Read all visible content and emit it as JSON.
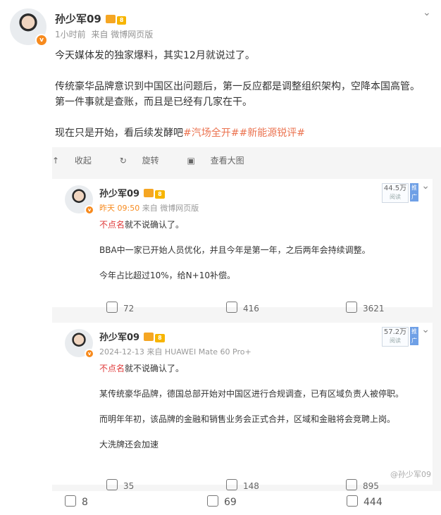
{
  "main": {
    "username": "孙少军09",
    "level_badge": "8",
    "avatar_badge": "v",
    "time": "1小时前",
    "source": "来自 微博网页版",
    "paragraphs": [
      "今天媒体发的独家爆料，其实12月就说过了。",
      "传统豪华品牌意识到中国区出问题后，第一反应都是调整组织架构，空降本国高管。第一件事就是查账，而且是已经有几家在干。",
      "现在只是开始，看后续发酵吧"
    ],
    "tags": [
      "#汽场全开#",
      "#新能源锐评#"
    ]
  },
  "repost_bar": {
    "collect": "收起",
    "repost": "旋转",
    "view_big": "查看大图"
  },
  "cards": [
    {
      "username": "孙少军09",
      "level_badge": "8",
      "time": "昨天 09:50",
      "source": "来自 微博网页版",
      "views": "44.5万",
      "views_sub": "阅读",
      "promo": "推广",
      "lead_red": "不点名",
      "lead_rest": "就不说确认了。",
      "paragraphs": [
        "BBA中一家已开始人员优化，并且今年是第一年，之后两年会持续调整。",
        "今年占比超过10%，给N+10补偿。"
      ],
      "reposts": "72",
      "comments": "416",
      "likes": "3621"
    },
    {
      "username": "孙少军09",
      "level_badge": "8",
      "time": "2024-12-13",
      "source": "来自 HUAWEI Mate 60 Pro+",
      "views": "57.2万",
      "views_sub": "阅读",
      "promo": "推广",
      "lead_red": "不点名",
      "lead_rest": "就不说确认了。",
      "paragraphs": [
        "某传统豪华品牌，德国总部开始对中国区进行合规调查，已有区域负责人被停职。",
        "而明年年初，该品牌的金融和销售业务会正式合并，区域和金融将会竞聘上岗。",
        "大洗牌还会加速"
      ],
      "reposts": "35",
      "comments": "148",
      "likes": "895"
    }
  ],
  "footer": {
    "reposts": "8",
    "comments": "69",
    "likes": "444",
    "watermark": "@孙少军09"
  }
}
